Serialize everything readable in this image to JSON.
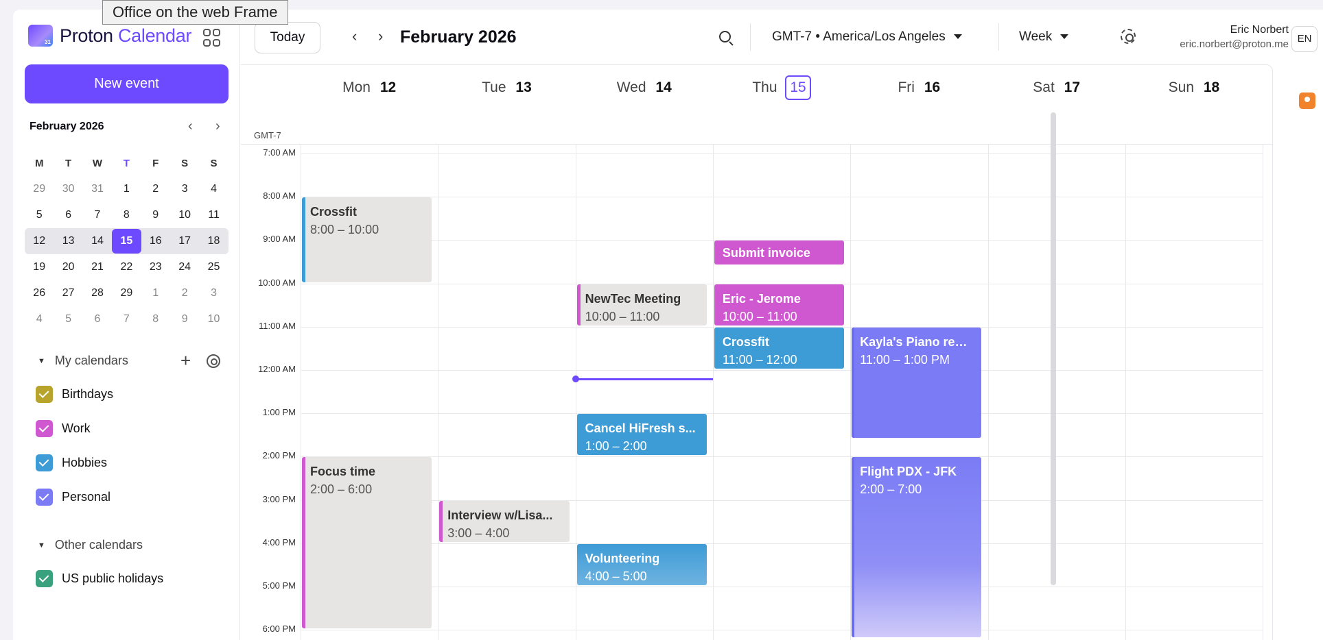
{
  "tooltip": "Office on the web Frame",
  "sidebar": {
    "logo_brand": "Proton",
    "logo_product": "Calendar",
    "new_event": "New event",
    "mini": {
      "month": "February 2026",
      "dow": [
        "M",
        "T",
        "W",
        "T",
        "F",
        "S",
        "S"
      ],
      "weeks": [
        [
          "29",
          "30",
          "31",
          "1",
          "2",
          "3",
          "4"
        ],
        [
          "5",
          "6",
          "7",
          "8",
          "9",
          "10",
          "11"
        ],
        [
          "12",
          "13",
          "14",
          "15",
          "16",
          "17",
          "18"
        ],
        [
          "19",
          "20",
          "21",
          "22",
          "23",
          "24",
          "25"
        ],
        [
          "26",
          "27",
          "28",
          "29",
          "1",
          "2",
          "3"
        ],
        [
          "4",
          "5",
          "6",
          "7",
          "8",
          "9",
          "10"
        ]
      ]
    },
    "my_calendars": "My calendars",
    "calendars": [
      {
        "label": "Birthdays",
        "color": "#b8a42c"
      },
      {
        "label": "Work",
        "color": "#cf58d1"
      },
      {
        "label": "Hobbies",
        "color": "#3d9bd6"
      },
      {
        "label": "Personal",
        "color": "#7b7cf5"
      }
    ],
    "other_calendars": "Other calendars",
    "others": [
      {
        "label": "US public holidays",
        "color": "#3aa17e"
      }
    ]
  },
  "toolbar": {
    "today": "Today",
    "prev": "‹",
    "next": "›",
    "period": "February 2026",
    "timezone": "GMT-7 • America/Los Angeles",
    "view": "Week",
    "user_name": "Eric Norbert",
    "user_email": "eric.norbert@proton.me",
    "avatar": "EN"
  },
  "week": {
    "gmt": "GMT-7",
    "days": [
      {
        "dow": "Mon",
        "num": "12"
      },
      {
        "dow": "Tue",
        "num": "13"
      },
      {
        "dow": "Wed",
        "num": "14"
      },
      {
        "dow": "Thu",
        "num": "15",
        "today": true
      },
      {
        "dow": "Fri",
        "num": "16"
      },
      {
        "dow": "Sat",
        "num": "17"
      },
      {
        "dow": "Sun",
        "num": "18"
      }
    ],
    "hours": [
      "7:00 AM",
      "8:00 AM",
      "9:00 AM",
      "10:00 AM",
      "11:00 AM",
      "12:00 AM",
      "1:00 PM",
      "2:00 PM",
      "3:00 PM",
      "4:00 PM",
      "5:00 PM",
      "6:00 PM"
    ],
    "events": [
      {
        "day": 0,
        "start": 8,
        "end": 10,
        "title": "Crossfit",
        "time": "8:00 – 10:00",
        "style": "grey",
        "bar": "#3d9bd6"
      },
      {
        "day": 0,
        "start": 14,
        "end": 18,
        "title": "Focus time",
        "time": "2:00 – 6:00",
        "style": "grey",
        "bar": "#cf58d1"
      },
      {
        "day": 1,
        "start": 15,
        "end": 16,
        "title": "Interview w/Lisa...",
        "time": "3:00 – 4:00",
        "style": "grey",
        "bar": "#cf58d1"
      },
      {
        "day": 2,
        "start": 10,
        "end": 11,
        "title": "NewTec Meeting",
        "time": "10:00 – 11:00",
        "style": "grey",
        "bar": "#cf58d1"
      },
      {
        "day": 2,
        "start": 13,
        "end": 14,
        "title": "Cancel HiFresh s...",
        "time": "1:00 – 2:00",
        "style": "blue"
      },
      {
        "day": 2,
        "start": 16,
        "end": 17,
        "title": "Volunteering",
        "time": "4:00 – 5:00",
        "style": "blue"
      },
      {
        "day": 3,
        "start": 9,
        "end": 9.6,
        "title": "Submit invoice",
        "time": "",
        "style": "pink"
      },
      {
        "day": 3,
        "start": 10,
        "end": 11,
        "title": "Eric - Jerome",
        "time": "10:00 – 11:00",
        "style": "pink"
      },
      {
        "day": 3,
        "start": 11,
        "end": 12,
        "title": "Crossfit",
        "time": "11:00 – 12:00",
        "style": "blue"
      },
      {
        "day": 4,
        "start": 11,
        "end": 13.6,
        "title": "Kayla's Piano reci...",
        "time": "11:00 – 1:00 PM",
        "style": "violet"
      },
      {
        "day": 4,
        "start": 14,
        "end": 18.2,
        "title": "Flight PDX - JFK",
        "time": "2:00 – 7:00",
        "style": "violet"
      }
    ],
    "now_hour": 12.2,
    "now_day": 2
  }
}
